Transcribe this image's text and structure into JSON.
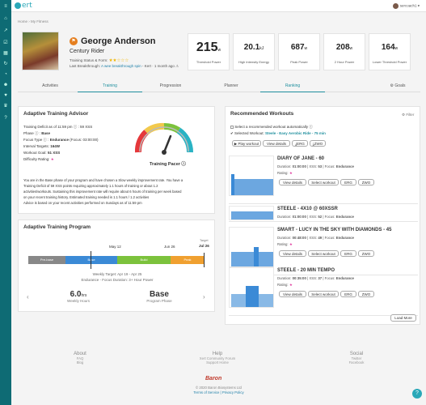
{
  "sidebar": {
    "icons": [
      "hamburger-icon",
      "home-icon",
      "chart-icon",
      "checkbox-icon",
      "calendar-icon",
      "refresh-icon",
      "dashboard-icon",
      "person-icon",
      "heart-icon",
      "trophy-icon",
      "info-icon"
    ]
  },
  "topbar": {
    "logo": "ert",
    "user": "sercoach1 ▾"
  },
  "breadcrumb": "Home › My Fitness",
  "profile": {
    "name": "George Anderson",
    "role": "Century Rider",
    "status_label": "Training Status & Form:",
    "stars": "★★☆☆☆",
    "breakthrough_label": "Last Breakthrough:",
    "breakthrough_link": "A wee breakthrough spin",
    "breakthrough_tail": "- Kert · 1 month ago ⚠"
  },
  "stats": [
    {
      "value": "215",
      "unit": "w",
      "label": "Threshold Power"
    },
    {
      "value": "20.1",
      "unit": "kJ",
      "label": "High Intensity Energy"
    },
    {
      "value": "687",
      "unit": "w",
      "label": "Peak Power"
    },
    {
      "value": "208",
      "unit": "w",
      "label": "2 Hour Power"
    },
    {
      "value": "164",
      "unit": "w",
      "label": "Lower Threshold Power"
    }
  ],
  "tabs": [
    "Activities",
    "Training",
    "Progression",
    "Planner",
    "Ranking"
  ],
  "goals": "Goals",
  "advisor": {
    "title": "Adaptive Training Advisor",
    "deficit": "Training Deficit as of 11:59 pm ⓘ : 59 XSS",
    "phase_label": "Phase ⓘ :",
    "phase": "Base",
    "focus_label": "Focus Type ⓘ :",
    "focus": "Endurance",
    "focus_extra": "(Focus: 03:00:00)",
    "interval_label": "Interval Targets:",
    "interval": "164W",
    "goal_label": "Workout Goal:",
    "goal": "51 XSS",
    "difficulty_label": "Difficulty Rating:",
    "difficulty": "★",
    "pacer": "Training Pacer ⓘ",
    "paragraph_lines": [
      "You are in the Base phase of your program and have chosen a Slow weekly improvement rate. You have a",
      "Training Deficit of 59 XSS points requiring approximately 1.1 hours of training or about 1.2",
      "activities/workouts. Sustaining this improvement rate will require about 6 hours of training per week based",
      "on your recent training history. Estimated training needed is 1.1 hours / 1.2 activities",
      "Advice is based on your recent activities performed on Sundays as of 11:59 pm"
    ]
  },
  "program": {
    "title": "Adaptive Training Program",
    "target_label": "Target",
    "target_date": "Jul 26",
    "dates": [
      "May 12",
      "Jun 26"
    ],
    "phases": [
      {
        "name": "Pre-base",
        "color": "#888888"
      },
      {
        "name": "Base",
        "color": "#3b8ad6"
      },
      {
        "name": "Build",
        "color": "#7cc23c"
      },
      {
        "name": "Peak",
        "color": "#f0a030"
      }
    ],
    "weekly_target": "Weekly Target: Apr 19 - Apr 25",
    "weekly_focus": "Endurance - Focus Duration: 3+ Hour Power",
    "hours_value": "6.0",
    "hours_unit": "hrs",
    "hours_caption": "Weekly Hours",
    "phase_value": "Base",
    "phase_caption": "Program Phase"
  },
  "recommended": {
    "title": "Recommended Workouts",
    "filter": "Filter",
    "auto_label": "Select a recommended workout automatically ⓘ",
    "selected_label": "✔ Selected Workout:",
    "selected_value": "Steele - Easy Aerobic Ride - 75 min",
    "top_buttons": [
      "Play workout",
      "View details",
      "ERG",
      "ZWO"
    ],
    "workouts": [
      {
        "name": "DIARY OF JANE - 60",
        "duration": "01:00:00",
        "xss": "53",
        "focus": "Endurance"
      },
      {
        "name": "STEELE - 4X10 @ 60XSSR",
        "duration": "01:00:00",
        "xss": "52",
        "focus": "Endurance"
      },
      {
        "name": "SMART - LUCY IN THE SKY WITH DIAMONDS - 45",
        "duration": "00:48:00",
        "xss": "49",
        "focus": "Endurance"
      },
      {
        "name": "STEELE - 20 MIN TEMPO",
        "duration": "00:35:00",
        "xss": "37",
        "focus": "Endurance"
      }
    ],
    "rating_label": "Rating:",
    "row_buttons": [
      "View details",
      "Select workout",
      "ERG",
      "ZWO"
    ],
    "load_more": "Load More"
  },
  "footer": {
    "cols": [
      {
        "head": "About",
        "items": [
          "FAQ",
          "Blog"
        ]
      },
      {
        "head": "Help",
        "items": [
          "Xert Community Forum",
          "Support Home"
        ]
      },
      {
        "head": "Social",
        "items": [
          "Twitter",
          "Facebook"
        ]
      }
    ],
    "brand": "Baron",
    "copyright": "© 2020 Baron Biosystems Ltd",
    "terms": "Terms of Service",
    "privacy": "Privacy Policy"
  }
}
